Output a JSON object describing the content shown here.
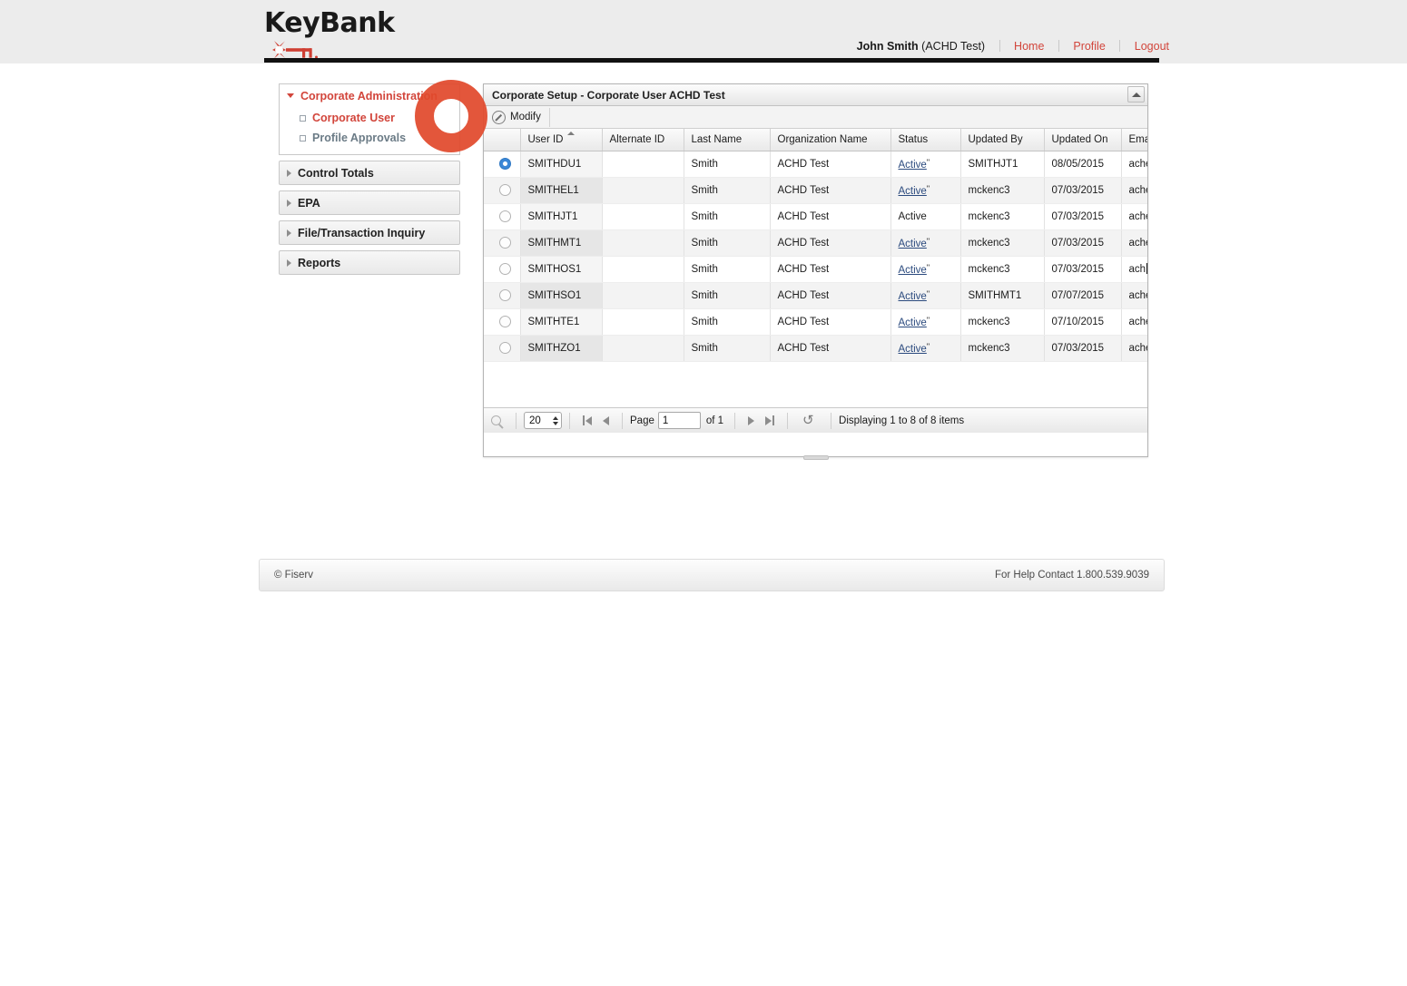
{
  "brand": {
    "name": "KeyBank",
    "key_icon": "key-icon"
  },
  "userbar": {
    "user_name": "John Smith",
    "user_org": " (ACHD Test)",
    "home": "Home",
    "profile": "Profile",
    "logout": "Logout",
    "link_color": "#d2453b"
  },
  "sidebar": {
    "groups": [
      {
        "label": "Corporate Administration",
        "open": true,
        "items": [
          {
            "label": "Corporate User",
            "active": true
          },
          {
            "label": "Profile Approvals",
            "active": false
          }
        ]
      },
      {
        "label": "Control Totals",
        "open": false,
        "items": []
      },
      {
        "label": "EPA",
        "open": false,
        "items": []
      },
      {
        "label": "File/Transaction Inquiry",
        "open": false,
        "items": []
      },
      {
        "label": "Reports",
        "open": false,
        "items": []
      }
    ]
  },
  "panel": {
    "title": "Corporate Setup - Corporate User ACHD Test",
    "collapse_icon": "collapse-up-icon",
    "toolbar": {
      "modify_label": "Modify",
      "modify_icon": "pencil-icon"
    }
  },
  "grid": {
    "columns": [
      {
        "key": "select",
        "label": ""
      },
      {
        "key": "user_id",
        "label": "User ID",
        "sorted": true
      },
      {
        "key": "alternate_id",
        "label": "Alternate ID"
      },
      {
        "key": "last_name",
        "label": "Last Name"
      },
      {
        "key": "organization_name",
        "label": "Organization Name"
      },
      {
        "key": "status",
        "label": "Status"
      },
      {
        "key": "updated_by",
        "label": "Updated By"
      },
      {
        "key": "updated_on",
        "label": "Updated On"
      },
      {
        "key": "email",
        "label": "Ema"
      }
    ],
    "rows": [
      {
        "selected": true,
        "user_id": "SMITHDU1",
        "alternate_id": "",
        "last_name": "Smith",
        "organization_name": "ACHD Test",
        "status": "Active",
        "status_link": true,
        "updated_by": "SMITHJT1",
        "updated_on": "08/05/2015",
        "email": "ache"
      },
      {
        "selected": false,
        "user_id": "SMITHEL1",
        "alternate_id": "",
        "last_name": "Smith",
        "organization_name": "ACHD Test",
        "status": "Active",
        "status_link": true,
        "updated_by": "mckenc3",
        "updated_on": "07/03/2015",
        "email": "ache"
      },
      {
        "selected": false,
        "user_id": "SMITHJT1",
        "alternate_id": "",
        "last_name": "Smith",
        "organization_name": "ACHD Test",
        "status": "Active",
        "status_link": false,
        "updated_by": "mckenc3",
        "updated_on": "07/03/2015",
        "email": "ache"
      },
      {
        "selected": false,
        "user_id": "SMITHMT1",
        "alternate_id": "",
        "last_name": "Smith",
        "organization_name": "ACHD Test",
        "status": "Active",
        "status_link": true,
        "updated_by": "mckenc3",
        "updated_on": "07/03/2015",
        "email": "ache"
      },
      {
        "selected": false,
        "user_id": "SMITHOS1",
        "alternate_id": "",
        "last_name": "Smith",
        "organization_name": "ACHD Test",
        "status": "Active",
        "status_link": true,
        "updated_by": "mckenc3",
        "updated_on": "07/03/2015",
        "email": "ach"
      },
      {
        "selected": false,
        "user_id": "SMITHSO1",
        "alternate_id": "",
        "last_name": "Smith",
        "organization_name": "ACHD Test",
        "status": "Active",
        "status_link": true,
        "updated_by": "SMITHMT1",
        "updated_on": "07/07/2015",
        "email": "ache"
      },
      {
        "selected": false,
        "user_id": "SMITHTE1",
        "alternate_id": "",
        "last_name": "Smith",
        "organization_name": "ACHD Test",
        "status": "Active",
        "status_link": true,
        "updated_by": "mckenc3",
        "updated_on": "07/10/2015",
        "email": "ache"
      },
      {
        "selected": false,
        "user_id": "SMITHZO1",
        "alternate_id": "",
        "last_name": "Smith",
        "organization_name": "ACHD Test",
        "status": "Active",
        "status_link": true,
        "updated_by": "mckenc3",
        "updated_on": "07/03/2015",
        "email": "ache"
      }
    ]
  },
  "pager": {
    "search_icon": "magnifier-icon",
    "page_size": "20",
    "first_icon": "first-page-icon",
    "prev_icon": "prev-page-icon",
    "page_label": "Page",
    "page_value": "1",
    "of_label": "of 1",
    "next_icon": "next-page-icon",
    "last_icon": "last-page-icon",
    "refresh_icon": "refresh-icon",
    "displaying": "Displaying 1 to 8 of 8 items"
  },
  "footer": {
    "copyright": "© Fiserv",
    "help": "For Help Contact 1.800.539.9039"
  },
  "cursor": {
    "highlight": "click-highlight-ring",
    "color": "#e1492c"
  }
}
